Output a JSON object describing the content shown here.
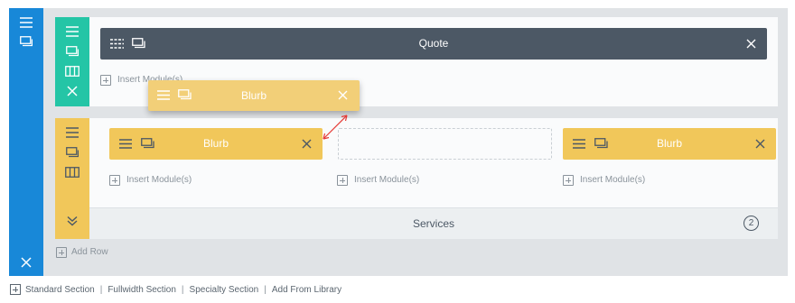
{
  "colors": {
    "section_accent": "#1888d8",
    "row1_accent": "#24c5a6",
    "row2_accent": "#f1c75a",
    "module_dark": "#4c5865",
    "module_yellow": "#f1c75a"
  },
  "icons": {
    "settings": "hamburger-icon",
    "duplicate": "duplicate-icon",
    "columns": "columns-icon",
    "delete": "close-icon",
    "expand": "double-chevron-down-icon",
    "add": "plus-box-icon",
    "drop_indicator": "double-arrow-icon"
  },
  "row1": {
    "module_label": "Quote",
    "insert_label": "Insert Module(s)"
  },
  "drag_preview": {
    "label": "Blurb"
  },
  "row2": {
    "columns": [
      {
        "module_label": "Blurb",
        "insert_label": "Insert Module(s)"
      },
      {
        "module_label": "",
        "insert_label": "Insert Module(s)"
      },
      {
        "module_label": "Blurb",
        "insert_label": "Insert Module(s)"
      }
    ],
    "collapsed_title": "Services",
    "collapsed_count": "2"
  },
  "add_row_label": "Add Row",
  "footer": {
    "links": [
      "Standard Section",
      "Fullwidth Section",
      "Specialty Section",
      "Add From Library"
    ],
    "separator": "|"
  }
}
